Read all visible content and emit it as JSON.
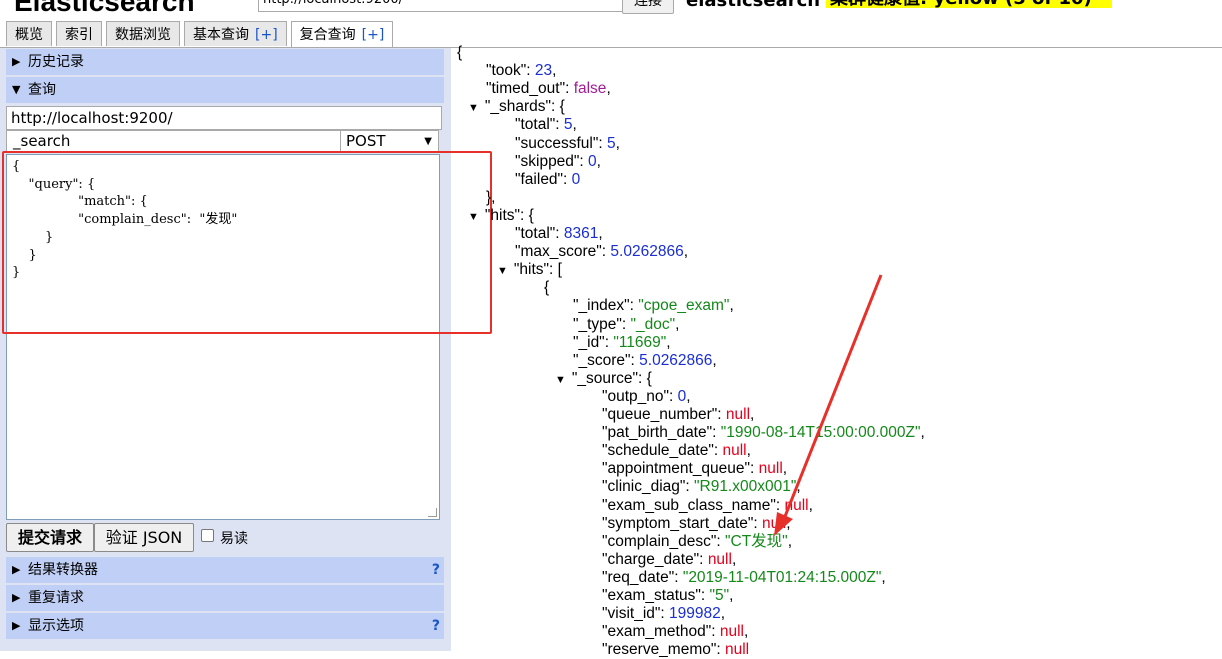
{
  "header": {
    "brand": "Elasticsearch",
    "url": "http://localhost:9200/",
    "connect_label": "连接",
    "cluster_name": "elasticsearch",
    "health": "集群健康值: yellow (5 of 10)"
  },
  "tabs": [
    {
      "label": "概览",
      "plus": ""
    },
    {
      "label": "索引",
      "plus": ""
    },
    {
      "label": "数据浏览",
      "plus": ""
    },
    {
      "label": "基本查询",
      "plus": "[+]"
    },
    {
      "label": "复合查询",
      "plus": "[+]"
    }
  ],
  "left": {
    "history_label": "历史记录",
    "query_label": "查询",
    "query_url": "http://localhost:9200/",
    "query_path": "_search",
    "query_method": "POST",
    "query_body": "{\n    \"query\": {\n                \"match\": {\n                \"complain_desc\":  \"发现\"\n        }\n    }\n}",
    "submit_label": "提交请求",
    "validate_label": "验证 JSON",
    "easy_read_label": "易读",
    "result_transformer_label": "结果转换器",
    "repeat_request_label": "重复请求",
    "display_options_label": "显示选项",
    "help_mark": "?"
  },
  "json_lines": [
    {
      "indent": 0,
      "t": "",
      "p": "{",
      "k": "",
      "v": "",
      "c": ""
    },
    {
      "indent": 1,
      "t": "",
      "p": "",
      "k": "\"took\": ",
      "v": "23",
      "c": "n",
      "tail": ","
    },
    {
      "indent": 1,
      "t": "",
      "p": "",
      "k": "\"timed_out\": ",
      "v": "false",
      "c": "b",
      "tail": ","
    },
    {
      "indent": 1,
      "t": "▼",
      "p": "",
      "k": "\"_shards\": {",
      "v": "",
      "c": "",
      "tail": ""
    },
    {
      "indent": 2,
      "t": "",
      "p": "",
      "k": "\"total\": ",
      "v": "5",
      "c": "n",
      "tail": ","
    },
    {
      "indent": 2,
      "t": "",
      "p": "",
      "k": "\"successful\": ",
      "v": "5",
      "c": "n",
      "tail": ","
    },
    {
      "indent": 2,
      "t": "",
      "p": "",
      "k": "\"skipped\": ",
      "v": "0",
      "c": "n",
      "tail": ","
    },
    {
      "indent": 2,
      "t": "",
      "p": "",
      "k": "\"failed\": ",
      "v": "0",
      "c": "n",
      "tail": ""
    },
    {
      "indent": 1,
      "t": "",
      "p": "},",
      "k": "",
      "v": "",
      "c": "",
      "tail": ""
    },
    {
      "indent": 1,
      "t": "▼",
      "p": "",
      "k": "\"hits\": {",
      "v": "",
      "c": "",
      "tail": ""
    },
    {
      "indent": 2,
      "t": "",
      "p": "",
      "k": "\"total\": ",
      "v": "8361",
      "c": "n",
      "tail": ","
    },
    {
      "indent": 2,
      "t": "",
      "p": "",
      "k": "\"max_score\": ",
      "v": "5.0262866",
      "c": "n",
      "tail": ","
    },
    {
      "indent": 2,
      "t": "▼",
      "p": "",
      "k": "\"hits\": [",
      "v": "",
      "c": "",
      "tail": ""
    },
    {
      "indent": 3,
      "t": "",
      "p": "{",
      "k": "",
      "v": "",
      "c": "",
      "tail": ""
    },
    {
      "indent": 4,
      "t": "",
      "p": "",
      "k": "\"_index\": ",
      "v": "\"cpoe_exam\"",
      "c": "s",
      "tail": ","
    },
    {
      "indent": 4,
      "t": "",
      "p": "",
      "k": "\"_type\": ",
      "v": "\"_doc\"",
      "c": "s",
      "tail": ","
    },
    {
      "indent": 4,
      "t": "",
      "p": "",
      "k": "\"_id\": ",
      "v": "\"11669\"",
      "c": "s",
      "tail": ","
    },
    {
      "indent": 4,
      "t": "",
      "p": "",
      "k": "\"_score\": ",
      "v": "5.0262866",
      "c": "n",
      "tail": ","
    },
    {
      "indent": 4,
      "t": "▼",
      "p": "",
      "k": "\"_source\": {",
      "v": "",
      "c": "",
      "tail": ""
    },
    {
      "indent": 5,
      "t": "",
      "p": "",
      "k": "\"outp_no\": ",
      "v": "0",
      "c": "n",
      "tail": ","
    },
    {
      "indent": 5,
      "t": "",
      "p": "",
      "k": "\"queue_number\": ",
      "v": "null",
      "c": "nl",
      "tail": ","
    },
    {
      "indent": 5,
      "t": "",
      "p": "",
      "k": "\"pat_birth_date\": ",
      "v": "\"1990-08-14T15:00:00.000Z\"",
      "c": "s",
      "tail": ","
    },
    {
      "indent": 5,
      "t": "",
      "p": "",
      "k": "\"schedule_date\": ",
      "v": "null",
      "c": "nl",
      "tail": ","
    },
    {
      "indent": 5,
      "t": "",
      "p": "",
      "k": "\"appointment_queue\": ",
      "v": "null",
      "c": "nl",
      "tail": ","
    },
    {
      "indent": 5,
      "t": "",
      "p": "",
      "k": "\"clinic_diag\": ",
      "v": "\"R91.x00x001\"",
      "c": "s",
      "tail": ","
    },
    {
      "indent": 5,
      "t": "",
      "p": "",
      "k": "\"exam_sub_class_name\": ",
      "v": "null",
      "c": "nl",
      "tail": ","
    },
    {
      "indent": 5,
      "t": "",
      "p": "",
      "k": "\"symptom_start_date\": ",
      "v": "null",
      "c": "nl",
      "tail": ","
    },
    {
      "indent": 5,
      "t": "",
      "p": "",
      "k": "\"complain_desc\": ",
      "v": "\"CT发现\"",
      "c": "s",
      "tail": ","
    },
    {
      "indent": 5,
      "t": "",
      "p": "",
      "k": "\"charge_date\": ",
      "v": "null",
      "c": "nl",
      "tail": ","
    },
    {
      "indent": 5,
      "t": "",
      "p": "",
      "k": "\"req_date\": ",
      "v": "\"2019-11-04T01:24:15.000Z\"",
      "c": "s",
      "tail": ","
    },
    {
      "indent": 5,
      "t": "",
      "p": "",
      "k": "\"exam_status\": ",
      "v": "\"5\"",
      "c": "s",
      "tail": ","
    },
    {
      "indent": 5,
      "t": "",
      "p": "",
      "k": "\"visit_id\": ",
      "v": "199982",
      "c": "n",
      "tail": ","
    },
    {
      "indent": 5,
      "t": "",
      "p": "",
      "k": "\"exam_method\": ",
      "v": "null",
      "c": "nl",
      "tail": ","
    },
    {
      "indent": 5,
      "t": "",
      "p": "",
      "k": "\"reserve_memo\": ",
      "v": "null",
      "c": "nl",
      "tail": ""
    }
  ],
  "colors": {
    "annotation_red": "#e8302a",
    "section_header": "#c0cff5",
    "panel_bg": "#dde3f3",
    "health_yellow": "#ffff00",
    "json_number": "#1a2ed3",
    "json_string": "#14891a",
    "json_null": "#e3001b",
    "json_bool": "#a01c95"
  }
}
